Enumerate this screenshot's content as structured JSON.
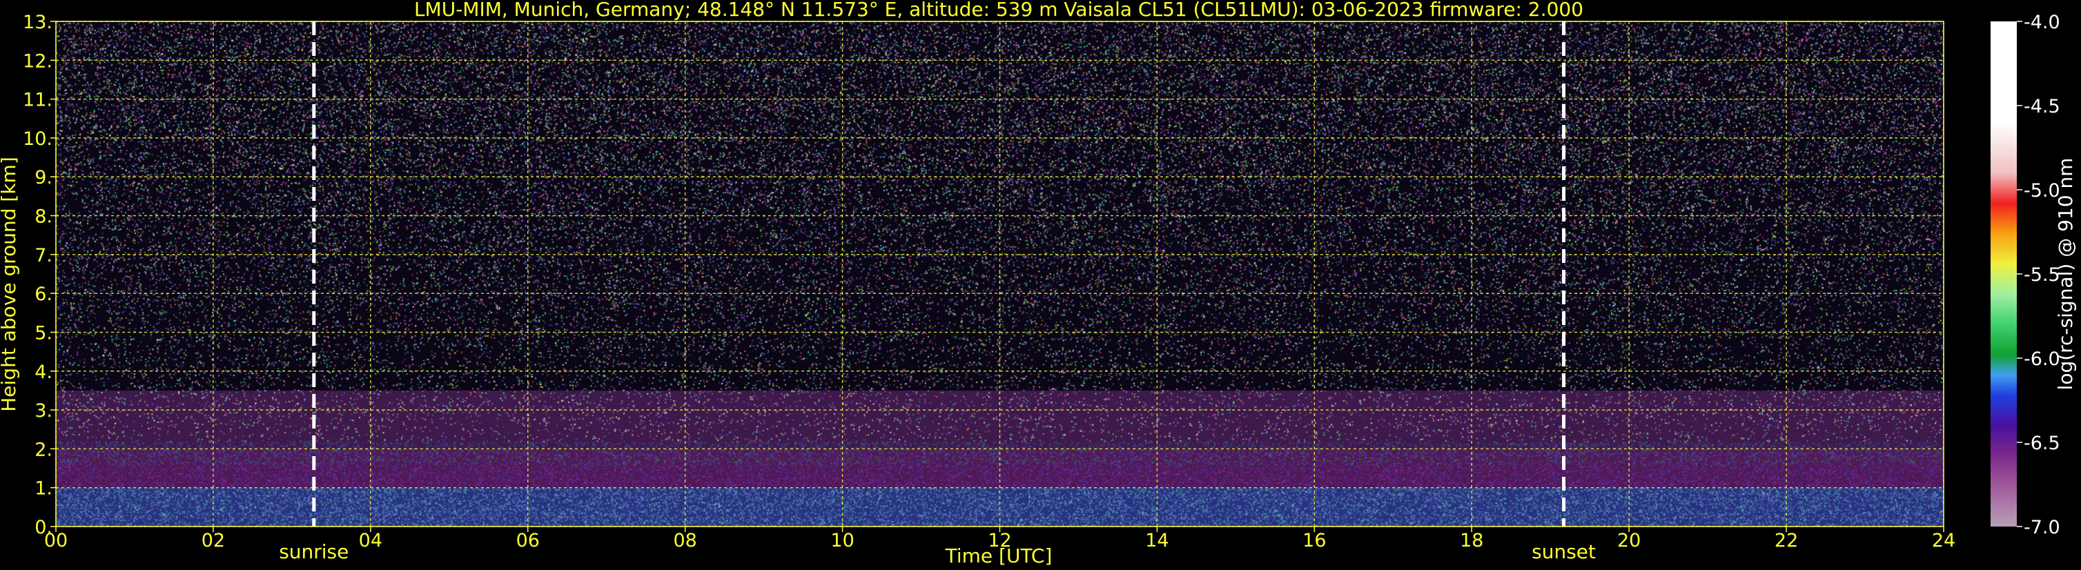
{
  "chart_data": {
    "type": "heatmap",
    "title": "LMU-MIM, Munich, Germany; 48.148° N 11.573° E, altitude: 539 m    Vaisala CL51 (CL51LMU): 03-06-2023    firmware: 2.000",
    "xlabel": "Time [UTC]",
    "ylabel": "Height above ground [km]",
    "xlim": [
      0,
      24
    ],
    "ylim": [
      0,
      13
    ],
    "xticks": [
      "00",
      "02",
      "04",
      "06",
      "08",
      "10",
      "12",
      "14",
      "16",
      "18",
      "20",
      "22",
      "24"
    ],
    "yticks": [
      "0.",
      "1.",
      "2.",
      "3.",
      "4.",
      "5.",
      "6.",
      "7.",
      "8.",
      "9.",
      "10.",
      "11.",
      "12.",
      "13."
    ],
    "grid": true,
    "colorbar": {
      "label": "log(rc-signal) @ 910 nm",
      "range": [
        -7.0,
        -4.0
      ],
      "ticks": [
        "-7.0",
        "-6.5",
        "-6.0",
        "-5.5",
        "-5.0",
        "-4.5",
        "-4.0"
      ]
    },
    "markers": [
      {
        "label": "sunrise",
        "x": 3.28
      },
      {
        "label": "sunset",
        "x": 19.17
      }
    ],
    "layers": [
      {
        "from_km": 0.0,
        "to_km": 1.0,
        "signal": -6.2
      },
      {
        "from_km": 1.0,
        "to_km": 2.0,
        "signal": -6.5
      },
      {
        "from_km": 2.0,
        "to_km": 3.5,
        "signal": -6.8
      }
    ]
  },
  "colors": {
    "background": "#000000",
    "text": "#ffff33",
    "grid": "#ffff33",
    "marker": "#ffffff"
  }
}
